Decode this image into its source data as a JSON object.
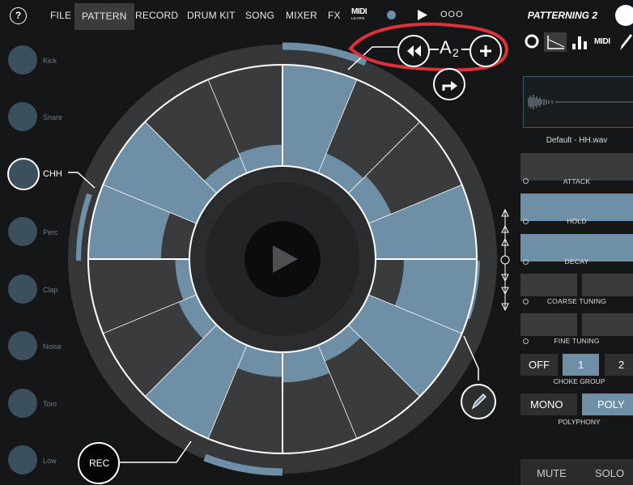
{
  "menu": {
    "help": "?",
    "items": [
      "FILE",
      "PATTERN",
      "RECORD",
      "DRUM KIT",
      "SONG",
      "MIXER",
      "FX"
    ],
    "midi_learn": "MIDI",
    "midi_learn_sub": "LEARN",
    "ellipsis": "OOO",
    "app_title": "PATTERNING 2"
  },
  "pattern": {
    "name_letter": "A",
    "name_number": "2"
  },
  "pads": [
    "Kick",
    "Snare",
    "CHH",
    "Perc",
    "Clap",
    "Noise",
    "Tom",
    "Low"
  ],
  "selected_pad": "CHH",
  "tabs": {
    "midi": "MIDI"
  },
  "sample": {
    "filename": "Default - HH.wav"
  },
  "sliders": [
    {
      "label": "ATTACK",
      "value": 0
    },
    {
      "label": "HOLD",
      "value": 1
    },
    {
      "label": "DECAY",
      "value": 1
    }
  ],
  "coarse_tuning": {
    "label": "COARSE TUNING"
  },
  "fine_tuning": {
    "label": "FINE TUNING"
  },
  "choke": {
    "label": "CHOKE GROUP",
    "options": [
      "OFF",
      "1",
      "2"
    ],
    "selected": "1"
  },
  "polyphony": {
    "label": "POLYPHONY",
    "options": [
      "MONO",
      "POLY"
    ],
    "selected": "POLY"
  },
  "rec": "REC",
  "mute": "MUTE",
  "solo": "SOLO",
  "colors": {
    "accent": "#6f8fa6",
    "highlight": "#e0303a",
    "bg": "#151617"
  }
}
